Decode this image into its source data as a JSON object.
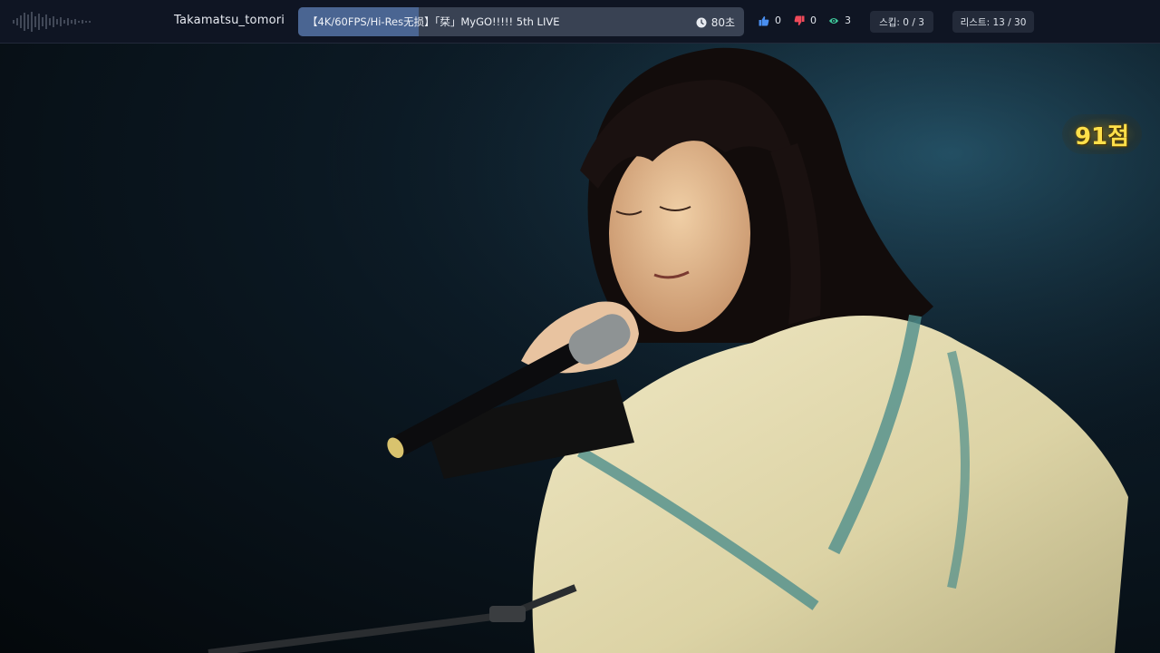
{
  "header": {
    "username": "Takamatsu_tomori",
    "video_title": "【4K/60FPS/Hi-Res无损】「栞」MyGO!!!!! 5th LIVE",
    "progress_fraction": 0.27,
    "timer": "80초",
    "likes": "0",
    "dislikes": "0",
    "views": "3",
    "skip": "스킵: 0 / 3",
    "list": "리스트: 13 / 30"
  },
  "video": {
    "score": "91점"
  },
  "colors": {
    "topbar": "#0f1523",
    "title_box": "#394253",
    "title_progress": "#4a6592",
    "like": "#4a8ff0",
    "dislike": "#ef4a5a",
    "view": "#3ec79a",
    "score": "#ffe04a"
  },
  "icons": [
    "waveform-logo-icon",
    "clock-icon",
    "thumbs-up-icon",
    "thumbs-down-icon",
    "eye-icon"
  ]
}
